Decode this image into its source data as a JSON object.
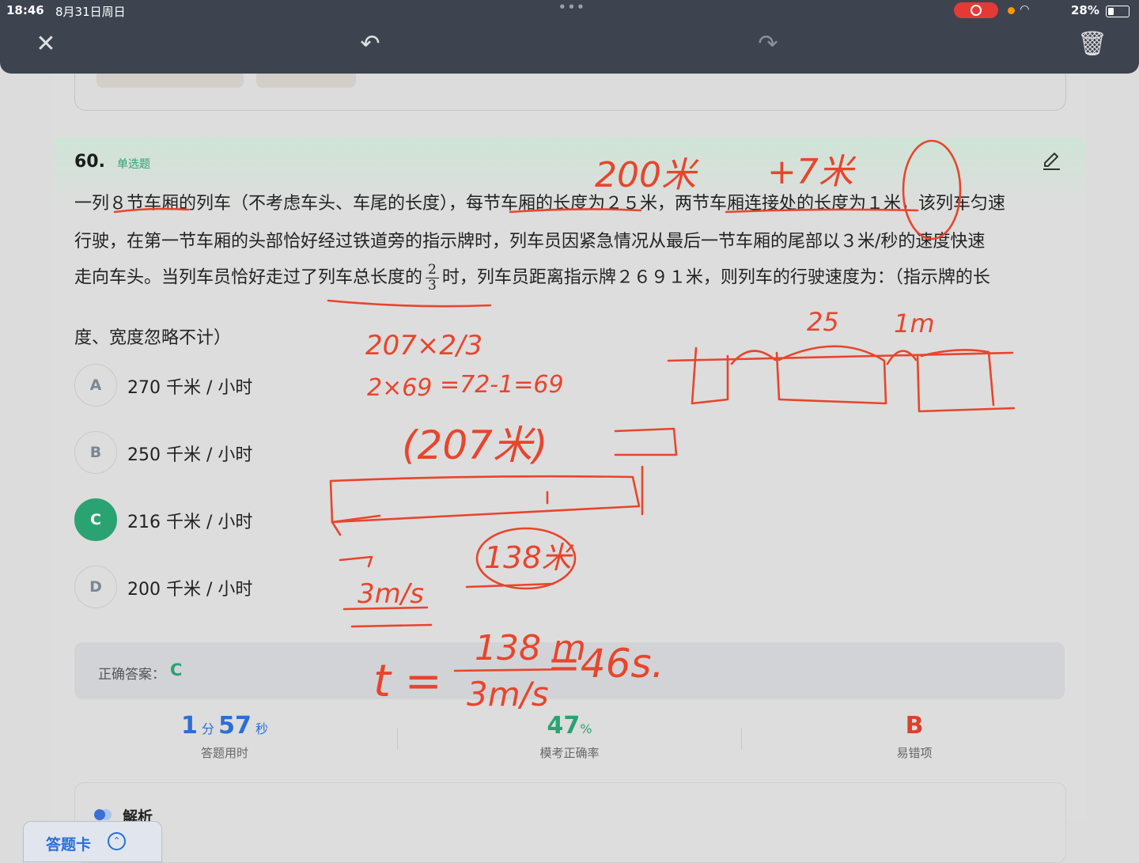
{
  "status_bar": {
    "time": "18:46",
    "date": "8月31日周日",
    "dots": "•••",
    "battery": "28%"
  },
  "toolbar": {
    "close_glyph": "✕",
    "undo_glyph": "↶",
    "redo_glyph": "↷",
    "trash_glyph": "🗑"
  },
  "question": {
    "number": "60.",
    "type": "单选题",
    "stem_line1": "一列８节车厢的列车（不考虑车头、车尾的长度），每节车厢的长度为２５米，两节车厢连接处的长度为１米，该列车匀速",
    "stem_line2": "行驶，在第一节车厢的头部恰好经过铁道旁的指示牌时，列车员因紧急情况从最后一节车厢的尾部以３米/秒的速度快速",
    "stem_line3_a": "走向车头。当列车员恰好走过了列车总长度的",
    "fraction_num": "2",
    "fraction_den": "3",
    "stem_line3_b": "时，列车员距离指示牌２６９１米，则列车的行驶速度为：（指示牌的长",
    "stem_line4": "度、宽度忽略不计）"
  },
  "options": [
    {
      "letter": "A",
      "text": "270 千米 / 小时"
    },
    {
      "letter": "B",
      "text": "250 千米 / 小时"
    },
    {
      "letter": "C",
      "text": "216 千米 / 小时"
    },
    {
      "letter": "D",
      "text": "200 千米 / 小时"
    }
  ],
  "answer": {
    "label": "正确答案：",
    "value": "C"
  },
  "stats": {
    "time_min": "1",
    "time_min_unit": "分",
    "time_sec": "57",
    "time_sec_unit": "秒",
    "time_label": "答题用时",
    "rate_value": "47",
    "rate_unit": "%",
    "rate_label": "模考正确率",
    "wrong_value": "B",
    "wrong_label": "易错项"
  },
  "analysis": {
    "title": "解析"
  },
  "answer_sheet": {
    "label": "答题卡",
    "icon": "⌃"
  },
  "handwriting": {
    "t1": "200米",
    "t2": "+7米",
    "t3": "25",
    "t4": "1m",
    "t5": "207×2/3",
    "t6": "2×69",
    "t7": "=72-1=69",
    "t8": "(207米)",
    "t9": "138米",
    "t10": "3m/s",
    "t11": "t =",
    "t12": "138 m",
    "t13": "3m/s",
    "t14": "=46s."
  },
  "colors": {
    "accent_green": "#2ba272",
    "accent_blue": "#2a6fd6",
    "error_red": "#d9432b",
    "ink": "#e8452c"
  }
}
